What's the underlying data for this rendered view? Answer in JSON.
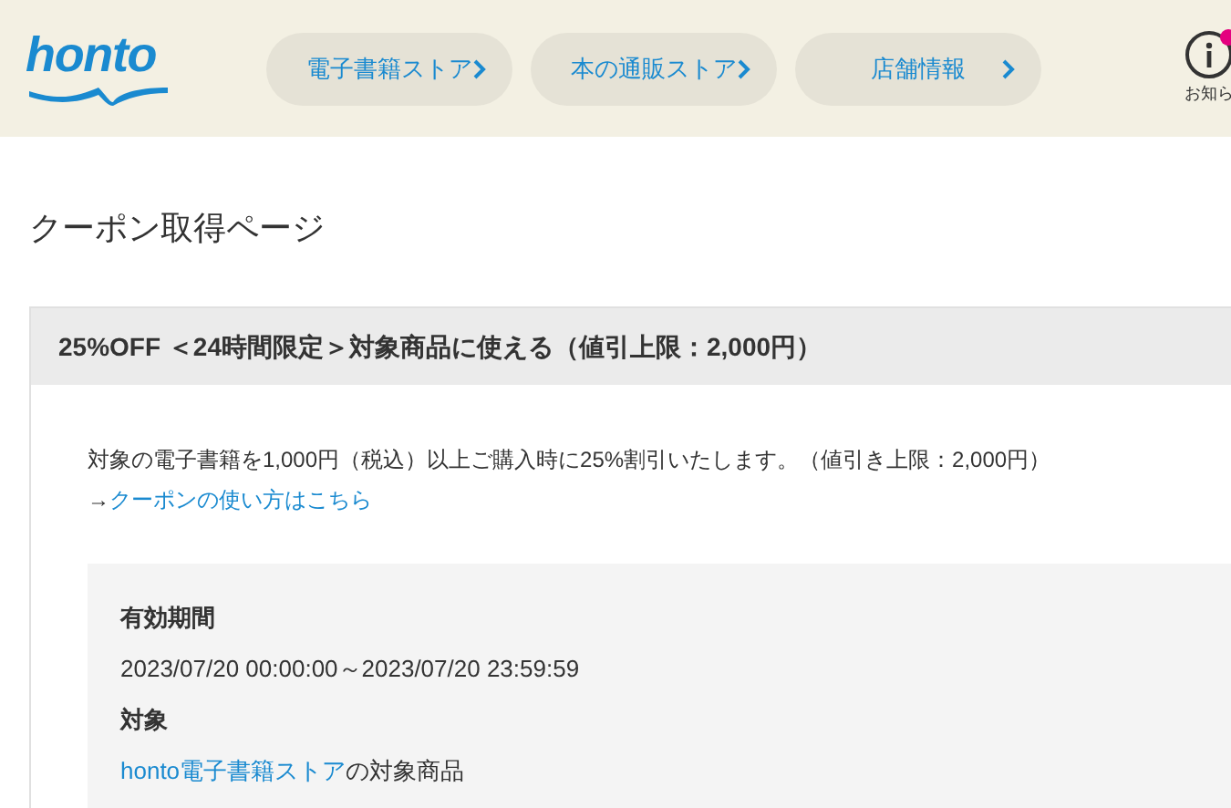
{
  "header": {
    "logo": "honto",
    "nav": [
      {
        "label": "電子書籍ストア"
      },
      {
        "label": "本の通販ストア"
      },
      {
        "label": "店舗情報"
      }
    ],
    "info": {
      "label": "お知ら"
    }
  },
  "page_title": "クーポン取得ページ",
  "coupon": {
    "title": "25%OFF ＜24時間限定＞対象商品に使える（値引上限：2,000円）",
    "description": "対象の電子書籍を1,000円（税込）以上ご購入時に25%割引いたします。（値引き上限：2,000円）",
    "howto": {
      "prefix": "→",
      "link": "クーポンの使い方はこちら"
    },
    "details": [
      {
        "label": "有効期間",
        "value": "2023/07/20 00:00:00～2023/07/20 23:59:59"
      },
      {
        "label": "対象",
        "link": "honto電子書籍ストア",
        "value": "の対象商品"
      }
    ]
  }
}
